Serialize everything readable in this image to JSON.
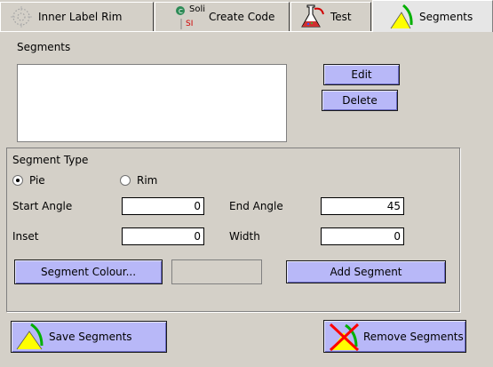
{
  "tabs": [
    {
      "label": "Inner Label Rim",
      "icon": "dotted-rim-icon",
      "selected": false
    },
    {
      "label": "Create Code",
      "icon": "create-code-icon",
      "icon_text": "Soli",
      "selected": false
    },
    {
      "label": "Test",
      "icon": "flask-icon",
      "selected": false
    },
    {
      "label": "Segments",
      "icon": "segment-icon",
      "selected": true
    }
  ],
  "segments": {
    "label": "Segments",
    "items": [],
    "edit_label": "Edit",
    "delete_label": "Delete"
  },
  "segment_type": {
    "title": "Segment Type",
    "options": [
      {
        "label": "Pie",
        "checked": true
      },
      {
        "label": "Rim",
        "checked": false
      }
    ],
    "start_angle_label": "Start Angle",
    "start_angle_value": "0",
    "end_angle_label": "End Angle",
    "end_angle_value": "45",
    "inset_label": "Inset",
    "inset_value": "0",
    "width_label": "Width",
    "width_value": "0",
    "colour_button_label": "Segment Colour...",
    "add_button_label": "Add Segment"
  },
  "footer": {
    "save_label": "Save Segments",
    "remove_label": "Remove Segments"
  },
  "colors": {
    "button_fill": "#b8b8f8",
    "background": "#d4d0c8",
    "segment_yellow": "#ffff00",
    "segment_green": "#00cc00",
    "remove_red": "#ff0000"
  }
}
